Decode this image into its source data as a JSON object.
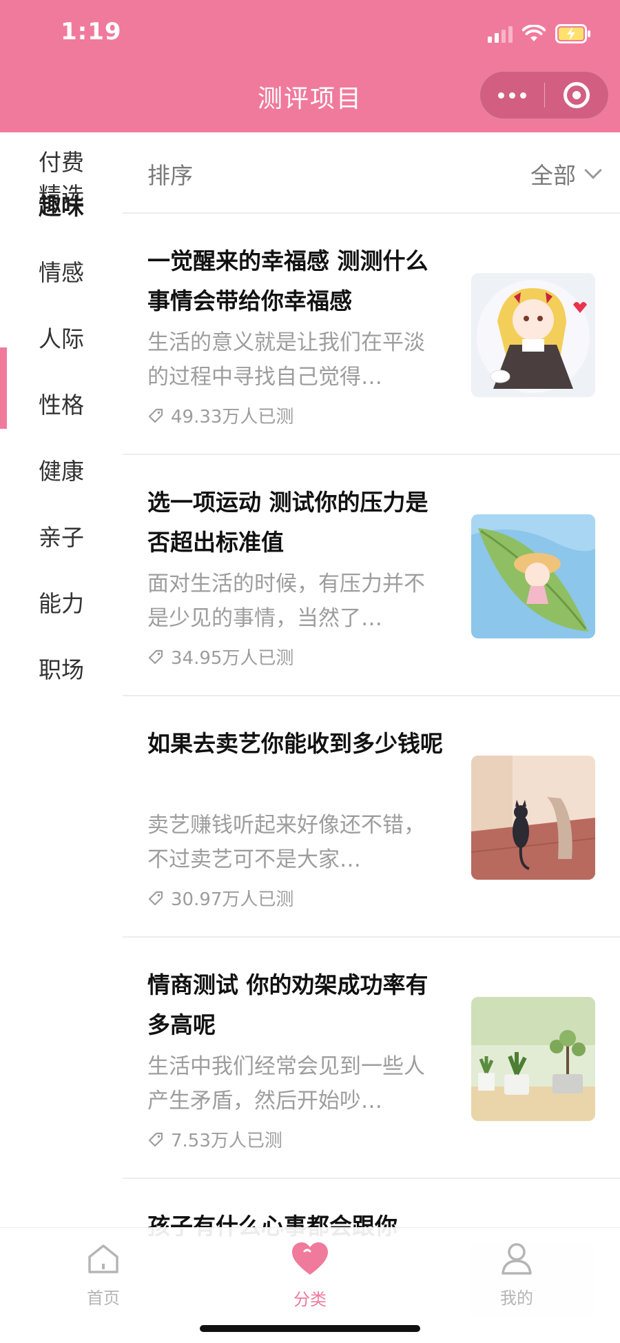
{
  "status_bar": {
    "time": "1:19"
  },
  "header": {
    "title": "测评项目"
  },
  "sidebar": {
    "items": [
      {
        "label": "付费精选"
      },
      {
        "label": "趣味",
        "active": true
      },
      {
        "label": "情感"
      },
      {
        "label": "人际"
      },
      {
        "label": "性格"
      },
      {
        "label": "健康"
      },
      {
        "label": "亲子"
      },
      {
        "label": "能力"
      },
      {
        "label": "职场"
      }
    ]
  },
  "sortbar": {
    "sort_label": "排序",
    "filter_label": "全部"
  },
  "list": [
    {
      "title": "一觉醒来的幸福感 测测什么事情会带给你幸福感",
      "desc": "生活的意义就是让我们在平淡的过程中寻找自己觉得…",
      "count": "49.33万人已测",
      "image": "girl-with-bunny-illustration"
    },
    {
      "title": "选一项运动 测试你的压力是否超出标准值",
      "desc": "面对生活的时候，有压力并不是少见的事情，当然了…",
      "count": "34.95万人已测",
      "image": "girl-on-leaf-illustration"
    },
    {
      "title": "如果去卖艺你能收到多少钱呢",
      "desc": "卖艺赚钱听起来好像还不错，不过卖艺可不是大家…",
      "count": "30.97万人已测",
      "image": "cat-shadow-illustration"
    },
    {
      "title": "情商测试 你的劝架成功率有多高呢",
      "desc": "生活中我们经常会见到一些人产生矛盾，然后开始吵…",
      "count": "7.53万人已测",
      "image": "potted-plants-illustration"
    },
    {
      "title": "孩子有什么心事都会跟你",
      "desc": "",
      "count": "",
      "image": "partial-illustration"
    }
  ],
  "tabbar": {
    "items": [
      {
        "label": "首页",
        "icon": "home-icon"
      },
      {
        "label": "分类",
        "icon": "heart-icon",
        "active": true
      },
      {
        "label": "我的",
        "icon": "user-icon"
      }
    ]
  },
  "colors": {
    "accent": "#f07a9c",
    "muted_text": "#9d9d9d"
  }
}
